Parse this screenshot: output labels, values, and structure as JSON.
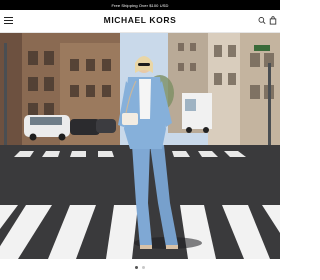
{
  "promo": {
    "text": "Free Shipping Over $100 USD"
  },
  "header": {
    "brand": "MICHAEL KORS",
    "icons": [
      "menu-icon",
      "search-icon",
      "shopping-bag-icon"
    ]
  },
  "hero": {
    "image_subject": "model-in-light-blue-suit-crossing-street"
  },
  "carousel": {
    "slides": 2,
    "active_index": 0
  },
  "colors": {
    "promo_bg": "#000000",
    "suit_blue": "#7fa8d4",
    "road": "#3a3a3c",
    "sky": "#c9d9ea"
  }
}
